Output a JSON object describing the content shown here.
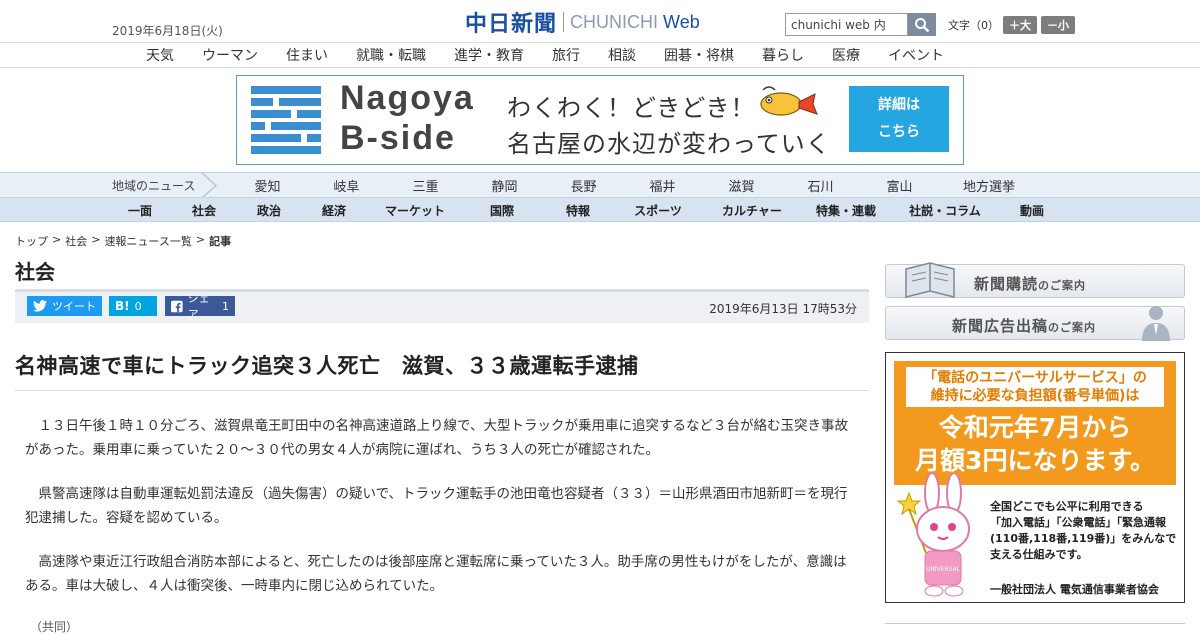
{
  "header": {
    "date": "2019年6月18日(火)",
    "logo_main": "中日新聞",
    "logo_sub_brand": "CHUNICHI",
    "logo_sub_web": "Web",
    "search_value": "chunichi web 内",
    "fontsize_label": "文字（0）",
    "fontsize_plus": "＋大",
    "fontsize_minus": "－小"
  },
  "nav_main": [
    "天気",
    "ウーマン",
    "住まい",
    "就職・転職",
    "進学・教育",
    "旅行",
    "相談",
    "囲碁・将棋",
    "暮らし",
    "医療",
    "イベント"
  ],
  "banner": {
    "title_line1": "Nagoya",
    "title_line2": "B-side",
    "copy_line1": "わくわく！どきどき！",
    "copy_line2": "名古屋の水辺が変わっていく",
    "cta_line1": "詳細は",
    "cta_line2": "こちら"
  },
  "nav_region": {
    "label": "地域のニュース",
    "items": [
      "愛知",
      "岐阜",
      "三重",
      "静岡",
      "長野",
      "福井",
      "滋賀",
      "石川",
      "富山",
      "地方選挙"
    ]
  },
  "nav_category": [
    "一面",
    "社会",
    "政治",
    "経済",
    "マーケット",
    "国際",
    "特報",
    "スポーツ",
    "カルチャー",
    "特集・連載",
    "社説・コラム",
    "動画"
  ],
  "breadcrumb": [
    "トップ",
    "社会",
    "速報ニュース一覧",
    "記事"
  ],
  "breadcrumb_sep": ">",
  "section_title": "社会",
  "share": {
    "tweet": "ツイート",
    "hatena_icon": "B!",
    "hatena_count": "0",
    "fb_label": "シェア",
    "fb_count": "1"
  },
  "article": {
    "published": "2019年6月13日 17時53分",
    "headline": "名神高速で車にトラック追突３人死亡　滋賀、３３歳運転手逮捕",
    "paragraphs": [
      "１３日午後１時１０分ごろ、滋賀県竜王町田中の名神高速道路上り線で、大型トラックが乗用車に追突するなど３台が絡む玉突き事故があった。乗用車に乗っていた２０～３０代の男女４人が病院に運ばれ、うち３人の死亡が確認された。",
      "県警高速隊は自動車運転処罰法違反（過失傷害）の疑いで、トラック運転手の池田竜也容疑者（３３）＝山形県酒田市旭新町＝を現行犯逮捕した。容疑を認めている。",
      "高速隊や東近江行政組合消防本部によると、死亡したのは後部座席と運転席に乗っていた３人。助手席の男性もけがをしたが、意識はある。車は大破し、４人は衝突後、一時車内に閉じ込められていた。"
    ],
    "credit": "（共同）"
  },
  "sidebar": {
    "subscribe_main": "新聞購読",
    "subscribe_sub": "のご案内",
    "advert_main": "新聞広告出稿",
    "advert_sub": "のご案内",
    "ad": {
      "line1a": "「電話のユニバーサルサービス」の",
      "line1b": "維持に必要な負担額(番号単価)は",
      "line2a": "令和元年7月から",
      "line2b": "月額3円になります。",
      "small_lines": [
        "全国どこでも公平に利用できる",
        "「加入電話」「公衆電話」「緊急通報",
        "(110番,118番,119番)」をみんなで",
        "支える仕組みです。"
      ],
      "org": "一般社団法人 電気通信事業者協会"
    }
  },
  "colors": {
    "brand": "#1a4fa3",
    "twitter": "#1d9bf0",
    "hatena": "#00a4de",
    "facebook": "#3b5998",
    "ad_orange": "#f39a1e",
    "banner_cta": "#26a6e0"
  }
}
